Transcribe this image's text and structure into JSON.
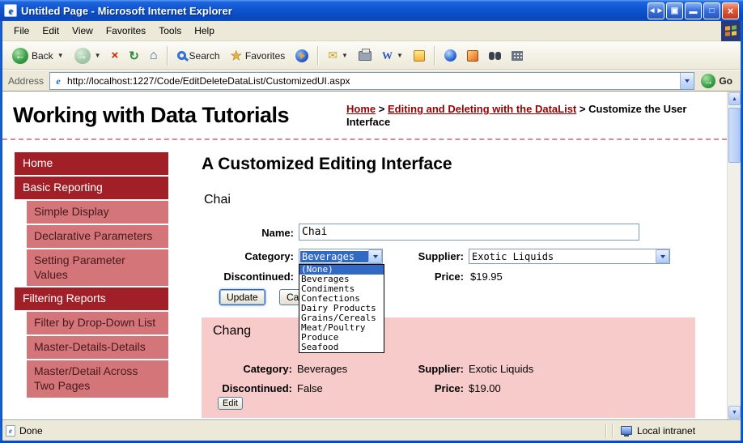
{
  "titlebar": {
    "title": "Untitled Page - Microsoft Internet Explorer"
  },
  "menubar": {
    "items": [
      "File",
      "Edit",
      "View",
      "Favorites",
      "Tools",
      "Help"
    ]
  },
  "toolbar": {
    "back_label": "Back",
    "search_label": "Search",
    "favorites_label": "Favorites"
  },
  "addressbar": {
    "label": "Address",
    "url": "http://localhost:1227/Code/EditDeleteDataList/CustomizedUI.aspx",
    "go_label": "Go"
  },
  "page": {
    "header": {
      "title": "Working with Data Tutorials",
      "breadcrumb": {
        "home": "Home",
        "separator": ">",
        "section": "Editing and Deleting with the DataList",
        "current": "Customize the User Interface"
      }
    },
    "sidebar": {
      "items": [
        {
          "label": "Home",
          "type": "section"
        },
        {
          "label": "Basic Reporting",
          "type": "section"
        },
        {
          "label": "Simple Display",
          "type": "sub"
        },
        {
          "label": "Declarative Parameters",
          "type": "sub"
        },
        {
          "label": "Setting Parameter Values",
          "type": "sub"
        },
        {
          "label": "Filtering Reports",
          "type": "section"
        },
        {
          "label": "Filter by Drop-Down List",
          "type": "sub"
        },
        {
          "label": "Master-Details-Details",
          "type": "sub"
        },
        {
          "label": "Master/Detail Across Two Pages",
          "type": "sub"
        }
      ]
    },
    "main": {
      "heading": "A Customized Editing Interface",
      "edit_item": {
        "product": "Chai",
        "name_label": "Name:",
        "name_value": "Chai",
        "category_label": "Category:",
        "category_value": "Beverages",
        "supplier_label": "Supplier:",
        "supplier_value": "Exotic Liquids",
        "discontinued_label": "Discontinued:",
        "price_label": "Price:",
        "price_value": "$19.95",
        "update_label": "Update",
        "cancel_label": "Cancel"
      },
      "category_dropdown": {
        "selected": "(None)",
        "options": [
          "(None)",
          "Beverages",
          "Condiments",
          "Confections",
          "Dairy Products",
          "Grains/Cereals",
          "Meat/Poultry",
          "Produce",
          "Seafood"
        ]
      },
      "view_item": {
        "product": "Chang",
        "category_label": "Category:",
        "category_value": "Beverages",
        "supplier_label": "Supplier:",
        "supplier_value": "Exotic Liquids",
        "discontinued_label": "Discontinued:",
        "discontinued_value": "False",
        "price_label": "Price:",
        "price_value": "$19.00",
        "edit_label": "Edit"
      }
    }
  },
  "statusbar": {
    "left": "Done",
    "right": "Local intranet"
  },
  "colors": {
    "accent_maroon": "#990000",
    "nav_section_bg": "#A11F27",
    "nav_sub_bg": "#D4757A",
    "view_item_bg": "#F8CBCB",
    "selection_blue": "#316AC5",
    "titlebar_blue": "#0F54CF"
  }
}
